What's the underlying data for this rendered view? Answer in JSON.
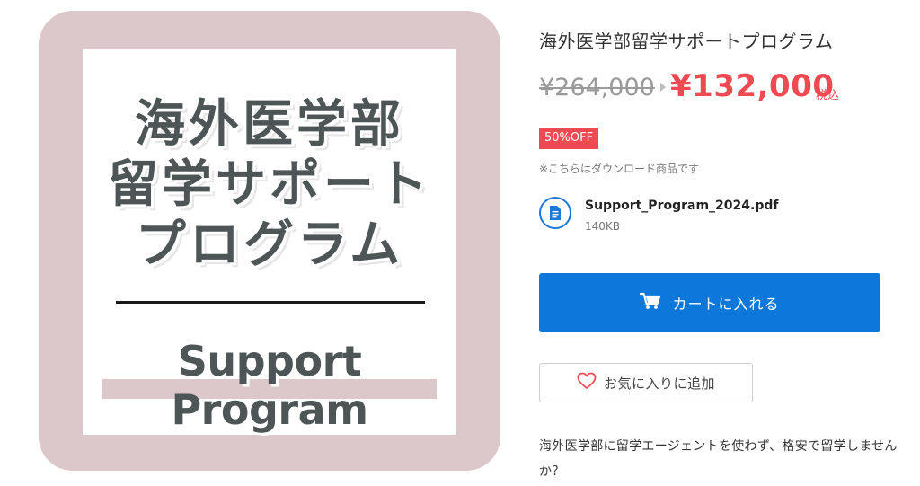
{
  "image": {
    "title_lines": [
      "海外医学部",
      "留学サポート",
      "プログラム"
    ],
    "subtitle": "Support Program",
    "colors": {
      "frame": "#dcc8cb",
      "text": "#4e5557"
    }
  },
  "product": {
    "title": "海外医学部留学サポートプログラム",
    "original_price": "¥264,000",
    "sale_price": "¥132,000",
    "tax_label": "税込",
    "discount_badge": "50%OFF",
    "download_note": "※こちらはダウンロード商品です",
    "file": {
      "name": "Support_Program_2024.pdf",
      "size": "140KB",
      "icon": "document-icon"
    },
    "add_to_cart": {
      "label": "カートに入れる",
      "icon": "cart-icon"
    },
    "wishlist": {
      "label": "お気に入りに追加",
      "icon": "heart-icon"
    },
    "description": "海外医学部に留学エージェントを使わず、格安で留学しませんか？"
  },
  "colors": {
    "accent": "#0d78da",
    "sale": "#ef4a52"
  }
}
